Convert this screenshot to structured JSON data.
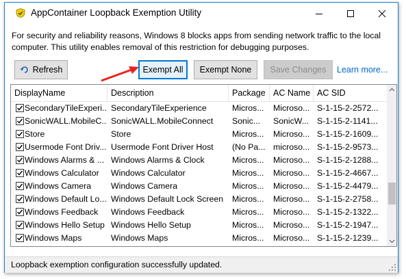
{
  "window": {
    "title": "AppContainer Loopback Exemption Utility",
    "accent_color": "#1883d7",
    "controls": [
      "minimize-icon",
      "maximize-icon",
      "close-icon"
    ]
  },
  "description": "For security and reliability reasons, Windows 8 blocks apps from sending network traffic to the local computer. This utility enables removal of this restriction for debugging purposes.",
  "toolbar": {
    "refresh_label": "Refresh",
    "exempt_all_label": "Exempt All",
    "exempt_none_label": "Exempt None",
    "save_changes_label": "Save Changes",
    "learn_more_label": "Learn more..."
  },
  "table": {
    "columns": [
      "DisplayName",
      "Description",
      "Package",
      "AC Name",
      "AC SID"
    ],
    "rows": [
      {
        "checked": true,
        "name": "SecondaryTileExperi...",
        "description": "SecondaryTileExperience",
        "package": "Micros...",
        "ac_name": "Microso...",
        "ac_sid": "S-1-15-2-2572..."
      },
      {
        "checked": true,
        "name": "SonicWALL.MobileC...",
        "description": "SonicWALL.MobileConnect",
        "package": "Sonic...",
        "ac_name": "SonicW...",
        "ac_sid": "S-1-15-2-1141..."
      },
      {
        "checked": true,
        "name": "Store",
        "description": "Store",
        "package": "Micros...",
        "ac_name": "Microso...",
        "ac_sid": "S-1-15-2-1609..."
      },
      {
        "checked": true,
        "name": "Usermode Font Driv...",
        "description": "Usermode Font Driver Host",
        "package": "(No Pa...",
        "ac_name": "microso...",
        "ac_sid": "S-1-15-2-9573..."
      },
      {
        "checked": true,
        "name": "Windows Alarms & ...",
        "description": "Windows Alarms & Clock",
        "package": "Micros...",
        "ac_name": "Microso...",
        "ac_sid": "S-1-15-2-1288..."
      },
      {
        "checked": true,
        "name": "Windows Calculator",
        "description": "Windows Calculator",
        "package": "Micros...",
        "ac_name": "Microso...",
        "ac_sid": "S-1-15-2-4667..."
      },
      {
        "checked": true,
        "name": "Windows Camera",
        "description": "Windows Camera",
        "package": "Micros...",
        "ac_name": "Microso...",
        "ac_sid": "S-1-15-2-4479..."
      },
      {
        "checked": true,
        "name": "Windows Default Lo...",
        "description": "Windows Default Lock Screen",
        "package": "Micros...",
        "ac_name": "Microso...",
        "ac_sid": "S-1-15-2-2758..."
      },
      {
        "checked": true,
        "name": "Windows Feedback",
        "description": "Windows Feedback",
        "package": "Micros...",
        "ac_name": "Microso...",
        "ac_sid": "S-1-15-2-1322..."
      },
      {
        "checked": true,
        "name": "Windows Hello Setup",
        "description": "Windows Hello Setup",
        "package": "Micros...",
        "ac_name": "Microso...",
        "ac_sid": "S-1-15-2-1947..."
      },
      {
        "checked": true,
        "name": "Windows Maps",
        "description": "Windows Maps",
        "package": "Micros...",
        "ac_name": "Microso...",
        "ac_sid": "S-1-15-2-1239..."
      }
    ]
  },
  "status": "Loopback exemption configuration successfully updated.",
  "annotation": {
    "arrow_color": "#e8221f",
    "points_to": "exempt-all-button"
  }
}
